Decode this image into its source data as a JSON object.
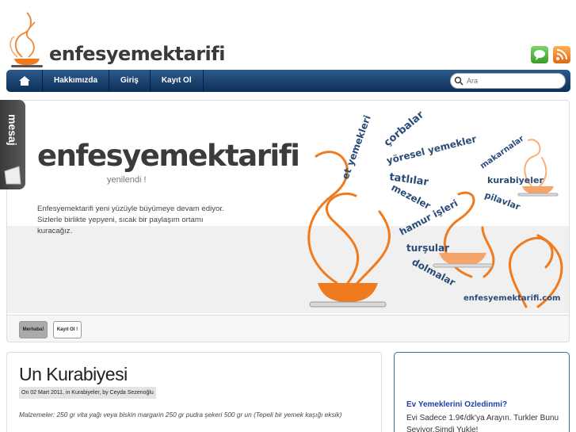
{
  "header": {
    "logo_text": "enfesyemektarifi",
    "icons": {
      "chat": "chat-bubble-icon",
      "rss": "rss-icon"
    }
  },
  "nav": {
    "home_icon": "home-icon",
    "items": [
      "Hakkımızda",
      "Giriş",
      "Kayıt Ol"
    ],
    "search_placeholder": "Ara"
  },
  "side_tab": {
    "label": "mesaj"
  },
  "banner": {
    "title": "enfesyemektarifi",
    "subtitle": "yenilendi !",
    "text": "Enfesyemektarifi yeni yüzüyle büyümeye devam ediyor. Sizlerle birlikte yepyeni, sıcak bir paylaşım ortamı kuracağız.",
    "words": [
      "et yemekleri",
      "çorbalar",
      "yöresel yemekler",
      "makarnalar",
      "tatlılar",
      "kurabiyeler",
      "mezeler",
      "pilavlar",
      "hamur işleri",
      "turşular",
      "dolmalar"
    ],
    "site": "enfesyemektarifi.com",
    "thumbs": [
      "Merhaba!",
      "Kayıt Ol !"
    ]
  },
  "post": {
    "title": "Un Kurabiyesi",
    "meta": "On 02 Mart 2011, in Kurabiyeler, by Ceyda Sezenoğlu",
    "excerpt": "Malzemeler: 250 gr vita yağı veya biskin margarin 250 gr pudra şekeri 500 gr un (Tepeli bir yemek kaşığı eksik)"
  },
  "ad": {
    "title": "Ev Yemeklerini Ozledinmi?",
    "body": "Evi Sadece 1.9¢/dk'ya Arayın. Turkler Bunu Seviyor.Simdi Yukle!"
  },
  "colors": {
    "nav": "#1b4470",
    "brand_orange": "#f07a1e",
    "word_blue": "#2a4b78",
    "ad_link": "#1b3fa8"
  }
}
